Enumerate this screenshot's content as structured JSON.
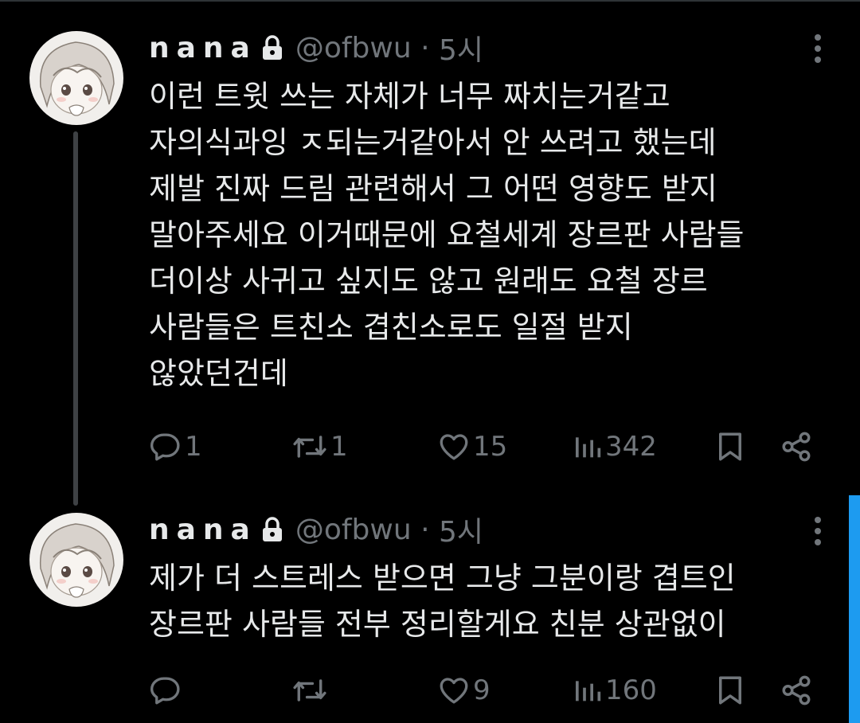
{
  "tweets": [
    {
      "display_name": "nana",
      "handle": "@ofbwu",
      "separator": " · ",
      "time": "5시",
      "text": "이런 트윗 쓰는 자체가 너무 짜치는거같고\n자의식과잉 ㅈ되는거같아서 안 쓰려고 했는데\n제발 진짜 드림 관련해서 그 어떤 영향도 받지\n말아주세요 이거때문에 요철세계 장르판 사람들\n더이상 사귀고 싶지도 않고 원래도 요철 장르\n사람들은 트친소 겹친소로도 일절 받지\n않았던건데",
      "replies": "1",
      "retweets": "1",
      "likes": "15",
      "views": "342"
    },
    {
      "display_name": "nana",
      "handle": "@ofbwu",
      "separator": " · ",
      "time": "5시",
      "text": "제가 더 스트레스 받으면 그냥 그분이랑 겹트인\n장르판 사람들 전부 정리할게요 친분 상관없이",
      "replies": "",
      "retweets": "",
      "likes": "9",
      "views": "160"
    }
  ],
  "colors": {
    "background": "#000000",
    "text": "#e7e9ea",
    "muted": "#71767b",
    "accent": "#1d9bf0"
  }
}
